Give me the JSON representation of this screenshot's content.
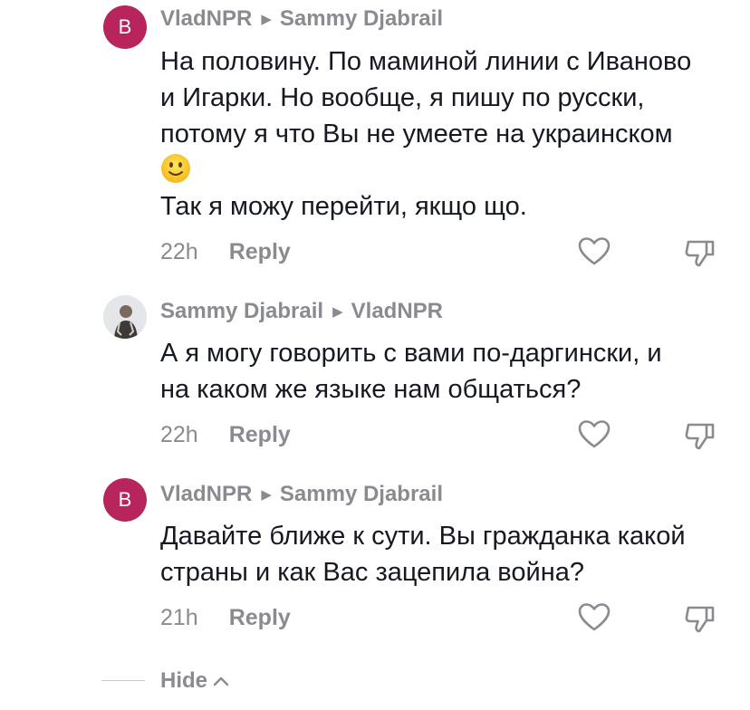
{
  "comments": [
    {
      "avatar_letter": "B",
      "author": "VladNPR",
      "reply_to": "Sammy Djabrail",
      "text_lines": [
        "На половину. По маминой линии с Иваново",
        "и Игарки. Но вообще, я пишу по русски,",
        "потому я что Вы не умеете на украинском"
      ],
      "emoji": "slightly-smiling-face",
      "text_after_emoji": "Так я можу перейти, якщо що.",
      "time": "22h",
      "reply_label": "Reply"
    },
    {
      "avatar_letter": "",
      "author": "Sammy Djabrail",
      "reply_to": "VladNPR",
      "text_lines": [
        "А я могу говорить с вами по-даргински, и",
        "на каком же языке нам общаться?"
      ],
      "time": "22h",
      "reply_label": "Reply"
    },
    {
      "avatar_letter": "B",
      "author": "VladNPR",
      "reply_to": "Sammy Djabrail",
      "text_lines": [
        "Давайте ближе к сути. Вы гражданка какой",
        "страны и как Вас зацепила война?"
      ],
      "time": "21h",
      "reply_label": "Reply"
    }
  ],
  "hide_label": "Hide",
  "icons": {
    "like": "heart-outline-icon",
    "dislike": "thumbs-down-outline-icon",
    "arrow": "triangle-right-icon",
    "chevron": "chevron-up-icon"
  },
  "colors": {
    "avatar_bg": "#b8245c",
    "text": "#161823",
    "muted": "#8a8b91"
  }
}
